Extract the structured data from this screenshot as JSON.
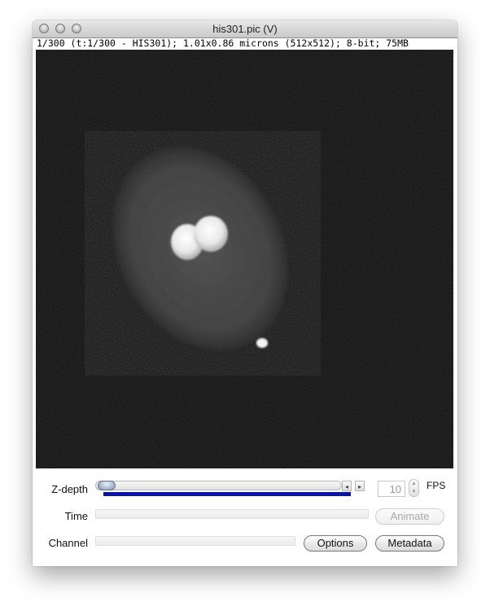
{
  "window": {
    "title": "his301.pic (V)"
  },
  "info": {
    "text": "1/300 (t:1/300 - HIS301); 1.01x0.86 microns (512x512); 8-bit; 75MB"
  },
  "controls": {
    "zdepth_label": "Z-depth",
    "time_label": "Time",
    "channel_label": "Channel",
    "zdepth_position": 0.0,
    "fps_value": "10",
    "fps_label": "FPS",
    "animate_label": "Animate",
    "options_label": "Options",
    "metadata_label": "Metadata",
    "arrow_left": "◂",
    "arrow_right": "▸",
    "stepper_up": "▴",
    "stepper_down": "▾"
  }
}
